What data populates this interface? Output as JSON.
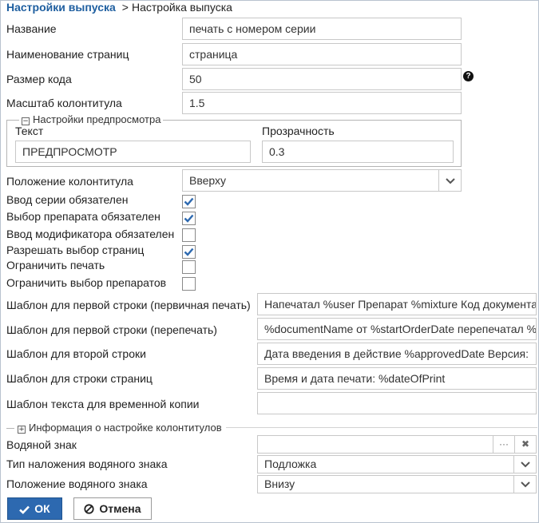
{
  "breadcrumb": {
    "root": "Настройки выпуска",
    "separator": ">",
    "current": "Настройка выпуска"
  },
  "fields": {
    "name": {
      "label": "Название",
      "value": "печать с номером серии"
    },
    "pages_name": {
      "label": "Наименование страниц",
      "value": "страница"
    },
    "code_size": {
      "label": "Размер кода",
      "value": "50"
    },
    "footer_scale": {
      "label": "Масштаб колонтитула",
      "value": "1.5"
    }
  },
  "preview": {
    "legend": "Настройки предпросмотра",
    "collapse_symbol": "−",
    "text_label": "Текст",
    "text_value": "ПРЕДПРОСМОТР",
    "opacity_label": "Прозрачность",
    "opacity_value": "0.3"
  },
  "footer_position": {
    "label": "Положение колонтитула",
    "value": "Вверху"
  },
  "checkboxes": [
    {
      "label": "Ввод серии обязателен",
      "checked": true
    },
    {
      "label": "Выбор препарата обязателен",
      "checked": true
    },
    {
      "label": "Ввод модификатора обязателен",
      "checked": false
    },
    {
      "label": "Разрешать выбор страниц",
      "checked": true
    },
    {
      "label": "Ограничить печать",
      "checked": false
    },
    {
      "label": "Ограничить выбор препаратов",
      "checked": false
    }
  ],
  "templates": [
    {
      "label": "Шаблон для первой строки (первичная печать)",
      "value": "Напечатал %user Препарат %mixture Код документа"
    },
    {
      "label": "Шаблон для первой строки (перепечать)",
      "value": "%documentName от %startOrderDate перепечатал %"
    },
    {
      "label": "Шаблон для второй строки",
      "value": "Дата введения в действие %approvedDate Версия:"
    },
    {
      "label": "Шаблон для строки страниц",
      "value": "Время и дата печати: %dateOfPrint"
    },
    {
      "label": "Шаблон текста для временной копии",
      "value": ""
    }
  ],
  "footer_info": {
    "legend": "Информация о настройке колонтитулов",
    "expand_symbol": "+"
  },
  "watermark": {
    "label": "Водяной знак",
    "value": "",
    "browse_symbol": "···",
    "clear_symbol": "✖"
  },
  "watermark_type": {
    "label": "Тип наложения водяного знака",
    "value": "Подложка"
  },
  "watermark_position": {
    "label": "Положение водяного знака",
    "value": "Внизу"
  },
  "help_symbol": "?",
  "buttons": {
    "ok": "ОК",
    "cancel": "Отмена"
  },
  "colors": {
    "accent": "#2d69b0",
    "breadcrumb": "#1f5fa0"
  }
}
